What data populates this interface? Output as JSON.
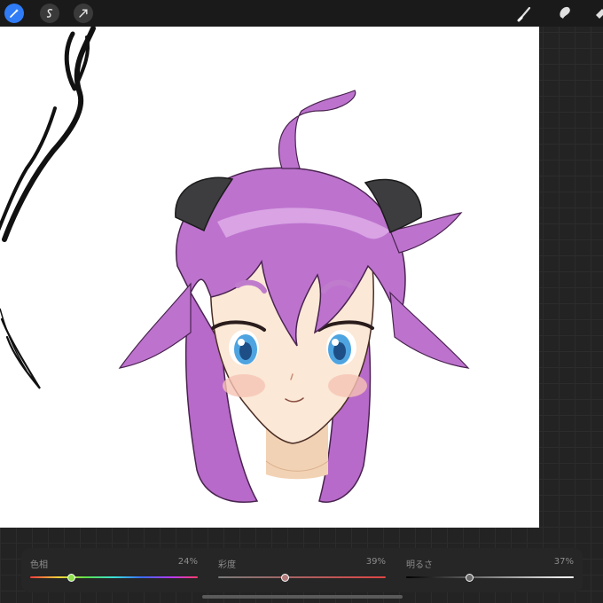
{
  "toolbar": {
    "left_tools": [
      "magic-wand-icon",
      "selection-icon",
      "transform-arrow-icon"
    ],
    "right_tools": [
      "brush-icon",
      "smudge-icon",
      "eraser-icon"
    ],
    "accent": "#2f7cf6"
  },
  "canvas": {
    "description_icon": "artwork",
    "background": "#ffffff"
  },
  "color_panel": {
    "sliders": [
      {
        "label": "色相",
        "value": "24%",
        "fraction": 0.24,
        "knob_color": "#8ee24a"
      },
      {
        "label": "彩度",
        "value": "39%",
        "fraction": 0.39,
        "knob_color": "#b37a7a"
      },
      {
        "label": "明るさ",
        "value": "37%",
        "fraction": 0.37,
        "knob_color": "#6a6a6a"
      }
    ]
  }
}
